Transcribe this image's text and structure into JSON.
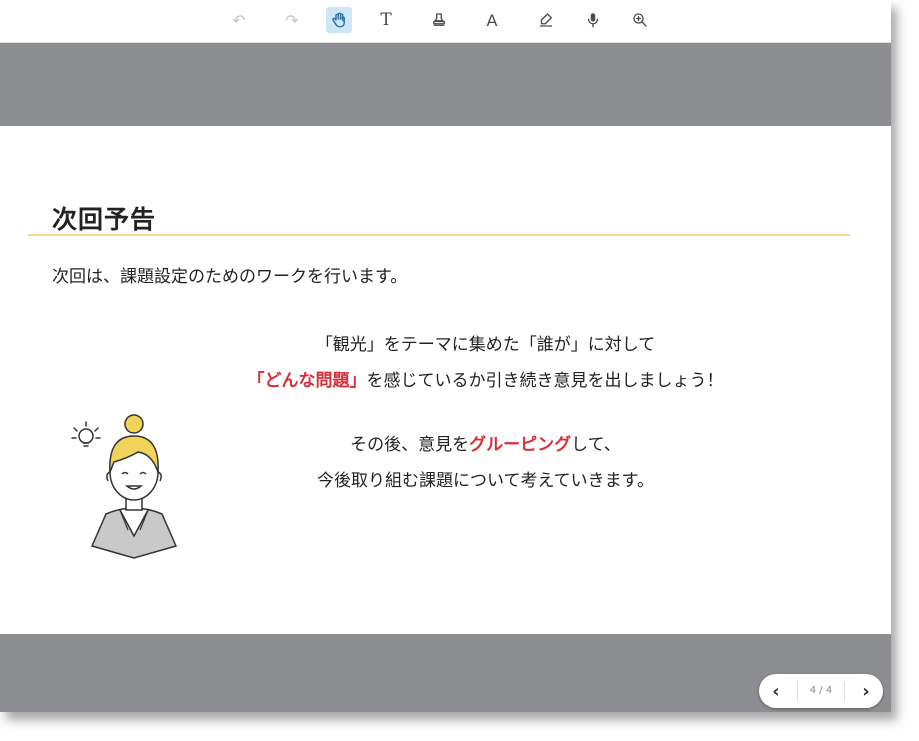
{
  "toolbar": {
    "tools": [
      {
        "name": "undo",
        "glyph": "↶"
      },
      {
        "name": "redo",
        "glyph": "↷"
      },
      {
        "name": "hand",
        "glyph": ""
      },
      {
        "name": "text",
        "glyph": "T"
      },
      {
        "name": "stamp",
        "glyph": ""
      },
      {
        "name": "font",
        "glyph": "A"
      },
      {
        "name": "highlight",
        "glyph": ""
      },
      {
        "name": "microphone",
        "glyph": ""
      },
      {
        "name": "zoom",
        "glyph": ""
      }
    ]
  },
  "slide": {
    "title": "次回予告",
    "intro": "次回は、課題設定のためのワークを行います。",
    "line1": "「観光」をテーマに集めた「誰が」に対して",
    "line2_red": "「どんな問題」",
    "line2_rest": "を感じているか引き続き意見を出しましょう！",
    "line3_pre": "その後、意見を",
    "line3_red": "グルーピング",
    "line3_post": "して、",
    "line4": "今後取り組む課題について考えていきます。"
  },
  "nav": {
    "prev": "‹",
    "page": "4 / 4",
    "next": "›"
  },
  "colors": {
    "accent_red": "#d6303a",
    "title_rule": "#f6d98a",
    "backdrop": "#8c8e91",
    "active_tool": "#cde7f7"
  }
}
